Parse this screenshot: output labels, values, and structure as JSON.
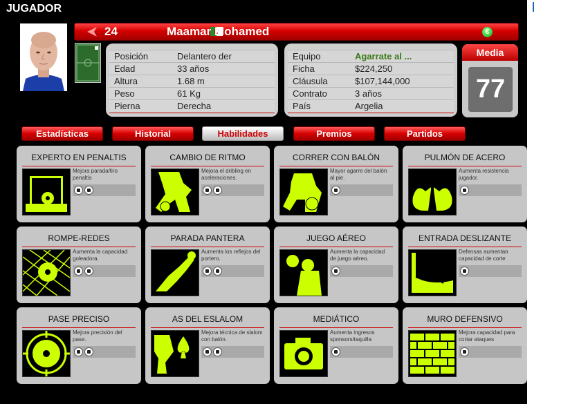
{
  "page_title": "JUGADOR",
  "player": {
    "number": "24",
    "name": "Maamar Mohamed",
    "currency_icon": "euro-icon",
    "media_label": "Media",
    "media_value": "77"
  },
  "personal": [
    {
      "label": "Posición",
      "value": "Delantero der"
    },
    {
      "label": "Edad",
      "value": "33 años"
    },
    {
      "label": "Altura",
      "value": "1.68 m"
    },
    {
      "label": "Peso",
      "value": "61 Kg"
    },
    {
      "label": "Pierna",
      "value": "Derecha"
    }
  ],
  "contract": [
    {
      "label": "Equipo",
      "value": "Agarrate al ..."
    },
    {
      "label": "Ficha",
      "value": "$224,250"
    },
    {
      "label": "Cláusula",
      "value": "$107,144,000"
    },
    {
      "label": "Contrato",
      "value": "3 años"
    },
    {
      "label": "País",
      "value": "Argelia"
    }
  ],
  "tabs": [
    {
      "label": "Estadísticas"
    },
    {
      "label": "Historial"
    },
    {
      "label": "Habilidades",
      "active": true
    },
    {
      "label": "Premios"
    },
    {
      "label": "Partidos"
    }
  ],
  "skills": [
    {
      "title": "EXPERTO EN PENALTIS",
      "desc": "Mejora parada/tiro penaltis",
      "level": 2,
      "icon": "penalty-goal-icon"
    },
    {
      "title": "CAMBIO DE RITMO",
      "desc": "Mejora el dribling en aceleraciones.",
      "level": 2,
      "icon": "running-player-icon"
    },
    {
      "title": "CORRER CON BALÓN",
      "desc": "Mayor agarre del balón al pie.",
      "level": 1,
      "icon": "dribbling-player-icon"
    },
    {
      "title": "PULMÓN DE ACERO",
      "desc": "Aumenta resistencia jugador.",
      "level": 1,
      "icon": "lungs-icon"
    },
    {
      "title": "ROMPE-REDES",
      "desc": "Aumenta la capacidad goleadora.",
      "level": 2,
      "icon": "ball-net-icon"
    },
    {
      "title": "PARADA PANTERA",
      "desc": "Aumenta los reflejos del portero.",
      "level": 2,
      "icon": "diving-goalkeeper-icon"
    },
    {
      "title": "JUEGO AÉREO",
      "desc": "Aumenta la capacidad de juego aéreo.",
      "level": 1,
      "icon": "header-player-icon"
    },
    {
      "title": "ENTRADA DESLIZANTE",
      "desc": "Defensas aumentan capacidad de corte",
      "level": 1,
      "icon": "sliding-tackle-icon"
    },
    {
      "title": "PASE PRECISO",
      "desc": "Mejora precisión del pase.",
      "level": 2,
      "icon": "target-ball-icon"
    },
    {
      "title": "AS DEL ESLALOM",
      "desc": "Mejora técnica de slalom con balón.",
      "level": 2,
      "icon": "ace-slalom-icon"
    },
    {
      "title": "MEDIÁTICO",
      "desc": "Aumenta ingresos sponsors/taquilla",
      "level": 1,
      "icon": "camera-icon"
    },
    {
      "title": "MURO DEFENSIVO",
      "desc": "Mejora capacidad para cortar ataques",
      "level": 1,
      "icon": "brick-wall-icon"
    }
  ],
  "colors": {
    "accent_red": "#d40000",
    "skill_green": "#ccff00",
    "card_gray": "#c6c6c6"
  }
}
